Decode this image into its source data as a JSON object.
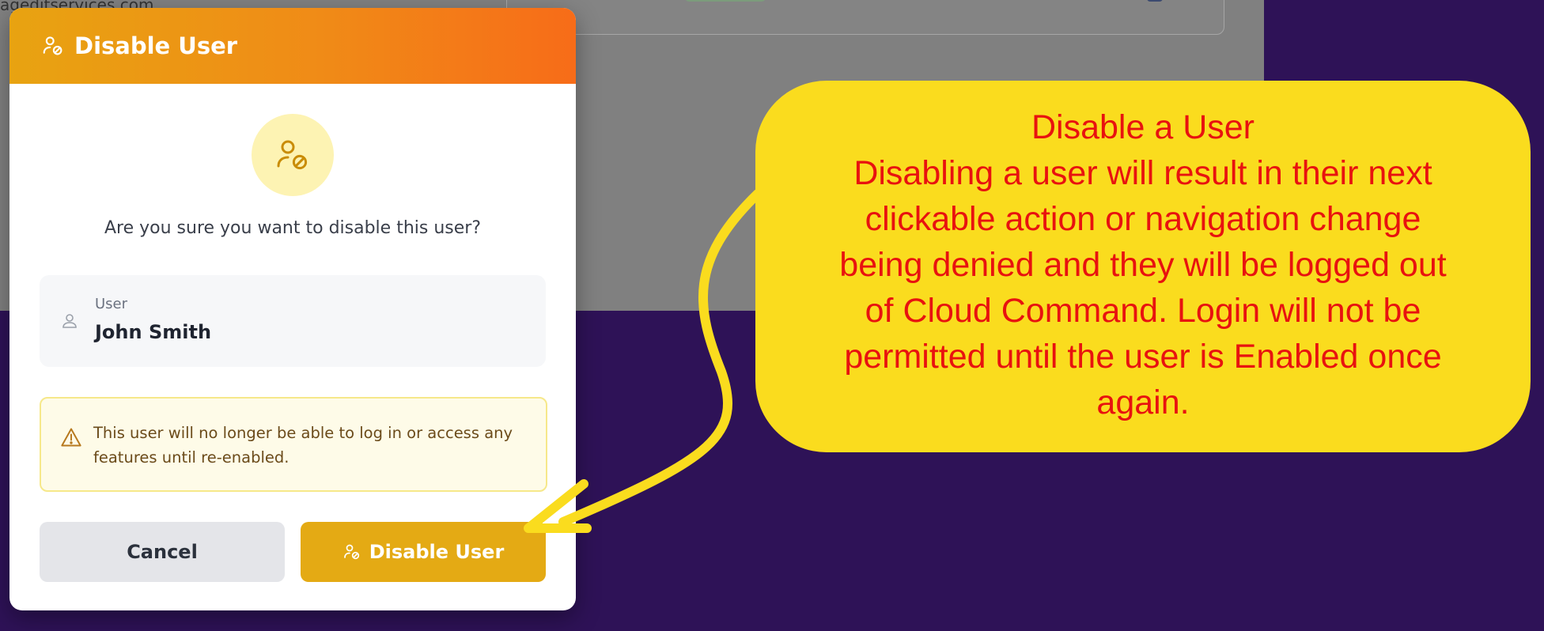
{
  "background": {
    "email_fragment": "ageditservices.com",
    "colors": {
      "page": "#2e1257",
      "overlay": "#808080"
    }
  },
  "modal": {
    "title": "Disable User",
    "title_icon": "user-disable-icon",
    "hero_icon": "user-disable-icon",
    "question": "Are you sure you want to disable this user?",
    "user_label": "User",
    "user_name": "John Smith",
    "user_icon": "user-icon",
    "warning_icon": "warning-triangle-icon",
    "warning_text": "This user will no longer be able to log in or access any features until re-enabled.",
    "cancel_label": "Cancel",
    "disable_label": "Disable User",
    "colors": {
      "header_start": "#e8a311",
      "header_end": "#f76c18",
      "disable_button": "#e4aa14",
      "warning_bg": "#fefbe8"
    }
  },
  "callout": {
    "title": "Disable a User",
    "body": "Disabling a user will result in their next clickable action or navigation change being denied and they will be logged out of Cloud Command. Login will not be permitted until the user is Enabled once again.",
    "colors": {
      "bubble": "#fadc1e",
      "text": "#e8120f",
      "arrow": "#fadc1e"
    }
  }
}
